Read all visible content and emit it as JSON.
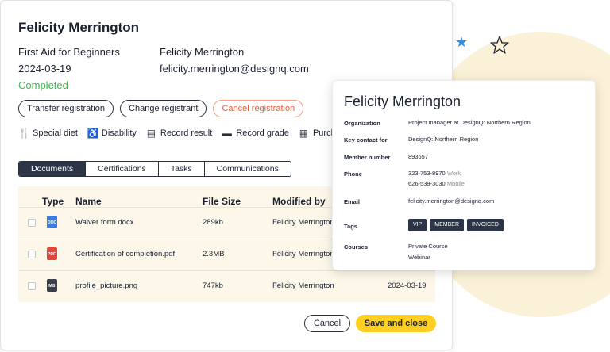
{
  "modal": {
    "title": "Felicity Merrington",
    "course": "First Aid for Beginners",
    "date": "2024-03-19",
    "status": "Completed",
    "registrant_name": "Felicity Merrington",
    "registrant_email": "felicity.merrington@designq.com",
    "buttons": {
      "transfer": "Transfer registration",
      "change": "Change registrant",
      "cancel_registration": "Cancel registration"
    },
    "actions": [
      {
        "label": "Special diet",
        "icon": "fork-knife-icon"
      },
      {
        "label": "Disability",
        "icon": "wheelchair-icon"
      },
      {
        "label": "Record result",
        "icon": "document-edit-icon"
      },
      {
        "label": "Record grade",
        "icon": "grade-card-icon"
      },
      {
        "label": "Purchas",
        "icon": "purchase-icon"
      }
    ],
    "tabs": [
      "Documents",
      "Certifications",
      "Tasks",
      "Communications"
    ],
    "active_tab": "Documents",
    "table": {
      "headers": [
        "Type",
        "Name",
        "File Size",
        "Modified by"
      ],
      "rows": [
        {
          "type": "docx",
          "name": "Waiver form.docx",
          "size": "289kb",
          "modified_by": "Felicity Merrington",
          "date": ""
        },
        {
          "type": "pdf",
          "name": "Certification of completion.pdf",
          "size": "2.3MB",
          "modified_by": "Felicity Merrington",
          "date": ""
        },
        {
          "type": "png",
          "name": "profile_picture.png",
          "size": "747kb",
          "modified_by": "Felicity Merrington",
          "date": "2024-03-19"
        }
      ]
    },
    "footer": {
      "cancel": "Cancel",
      "save": "Save and close"
    }
  },
  "card": {
    "name": "Felicity Merrington",
    "organization_label": "Organization",
    "organization": "Project manager at DesignQ: Northern Region",
    "key_contact_label": "Key contact for",
    "key_contact": "DesignQ: Northern Region",
    "member_number_label": "Member number",
    "member_number": "893657",
    "phone_label": "Phone",
    "phone_work": "323-753-8970",
    "phone_work_type": "Work",
    "phone_mobile": "626-539-3030",
    "phone_mobile_type": "Mobile",
    "email_label": "Email",
    "email": "felicity.merrington@designq.com",
    "tags_label": "Tags",
    "tags": [
      "VIP",
      "MEMBER",
      "INVOICED"
    ],
    "courses_label": "Courses",
    "courses": [
      "Private Course",
      "Webinar"
    ]
  },
  "colors": {
    "accent_yellow": "#ffcf24",
    "navy": "#2c3548",
    "status_green": "#3bb54a",
    "danger_orange": "#e0603a",
    "docx_blue": "#3d7fd6",
    "pdf_red": "#e0483b"
  }
}
